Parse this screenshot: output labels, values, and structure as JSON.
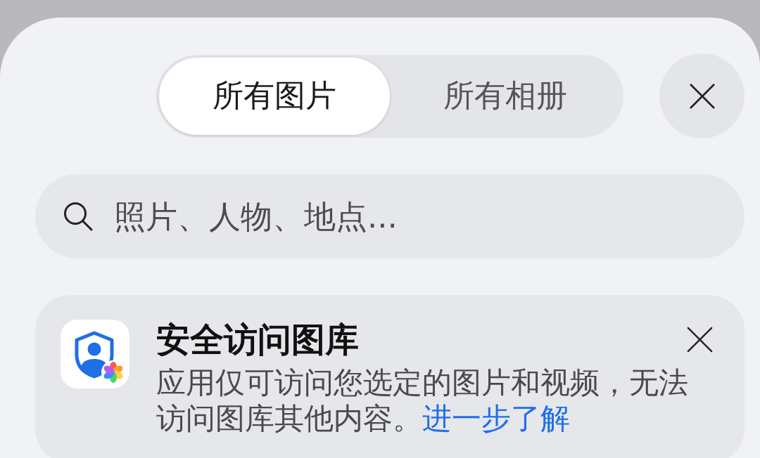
{
  "tabs": [
    {
      "label": "所有图片",
      "selected": true
    },
    {
      "label": "所有相册",
      "selected": false
    }
  ],
  "search": {
    "placeholder": "照片、人物、地点..."
  },
  "notice": {
    "title": "安全访问图库",
    "text": "应用仅可访问您选定的图片和视频，无法访问图库其他内容。",
    "link": "进一步了解"
  }
}
